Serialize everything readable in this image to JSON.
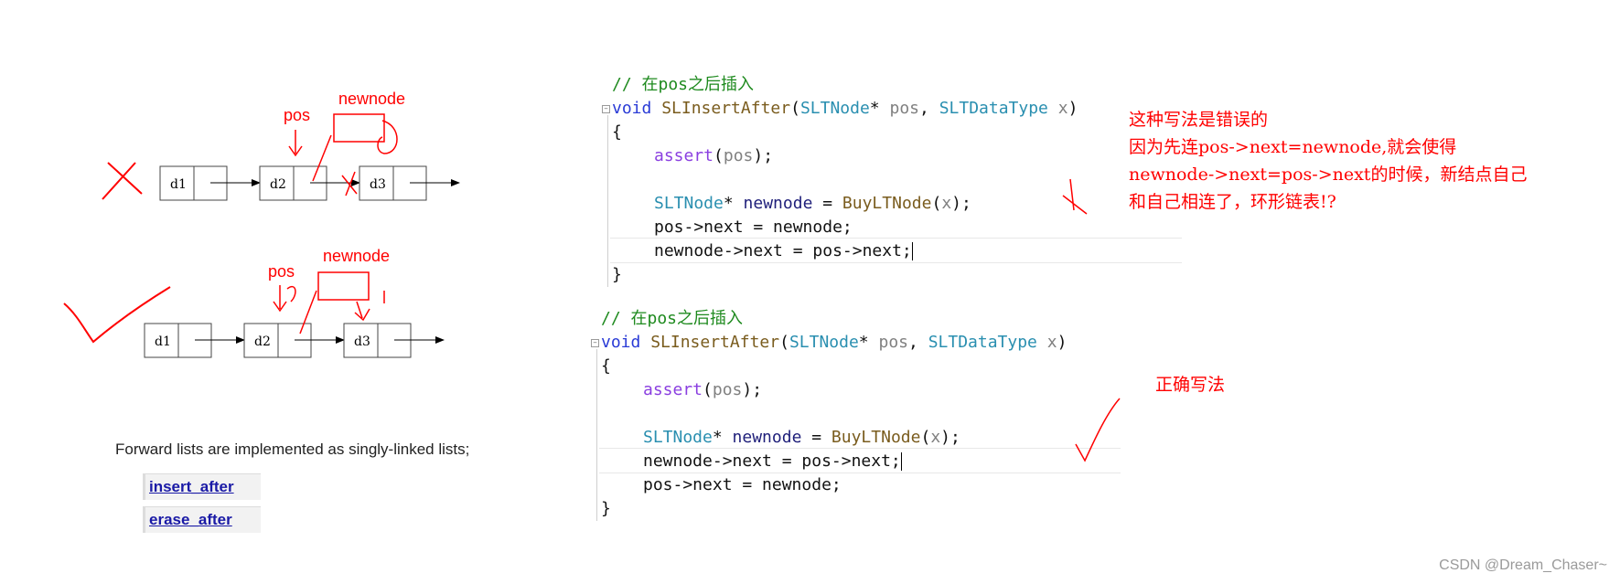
{
  "diagram_top": {
    "nodes": [
      "d1",
      "d2",
      "d3"
    ],
    "pos_label": "pos",
    "newnode_label": "newnode"
  },
  "diagram_bottom": {
    "nodes": [
      "d1",
      "d2",
      "d3"
    ],
    "pos_label": "pos",
    "newnode_label": "newnode"
  },
  "code_wrong": {
    "comment": "// 在pos之后插入",
    "sig_void": "void",
    "sig_fn": "SLInsertAfter",
    "sig_t1": "SLTNode",
    "sig_p1": "pos",
    "sig_t2": "SLTDataType",
    "sig_p2": "x",
    "open_brace": "{",
    "assert_fn": "assert",
    "assert_arg": "pos",
    "decl_type": "SLTNode",
    "decl_var": "newnode",
    "decl_fn": "BuyLTNode",
    "decl_arg": "x",
    "line_a": "pos->next = newnode;",
    "line_b": "newnode->next = pos->next;",
    "close_brace": "}"
  },
  "code_right": {
    "comment": "// 在pos之后插入",
    "sig_void": "void",
    "sig_fn": "SLInsertAfter",
    "sig_t1": "SLTNode",
    "sig_p1": "pos",
    "sig_t2": "SLTDataType",
    "sig_p2": "x",
    "open_brace": "{",
    "assert_fn": "assert",
    "assert_arg": "pos",
    "decl_type": "SLTNode",
    "decl_var": "newnode",
    "decl_fn": "BuyLTNode",
    "decl_arg": "x",
    "line_a": "newnode->next = pos->next;",
    "line_b": "pos->next = newnode;",
    "close_brace": "}"
  },
  "notes": {
    "wrong_line1": "这种写法是错误的",
    "wrong_line2": "因为先连pos->next=newnode,就会使得",
    "wrong_line3": "newnode->next=pos->next的时候，新结点自己",
    "wrong_line4": "和自己相连了，环形链表!?",
    "correct": "正确写法"
  },
  "reference": {
    "text": "Forward lists are implemented as singly-linked lists;",
    "link1": "insert_after",
    "link2": "erase_after"
  },
  "watermark": "CSDN @Dream_Chaser~",
  "colors": {
    "annotation_red": "#ff0000",
    "comment_green": "#1e8a1e",
    "keyword_blue": "#2a3bd6",
    "type_teal": "#2a8fb0",
    "function_brown": "#7a5c1e",
    "macro_purple": "#8a3fe0"
  }
}
